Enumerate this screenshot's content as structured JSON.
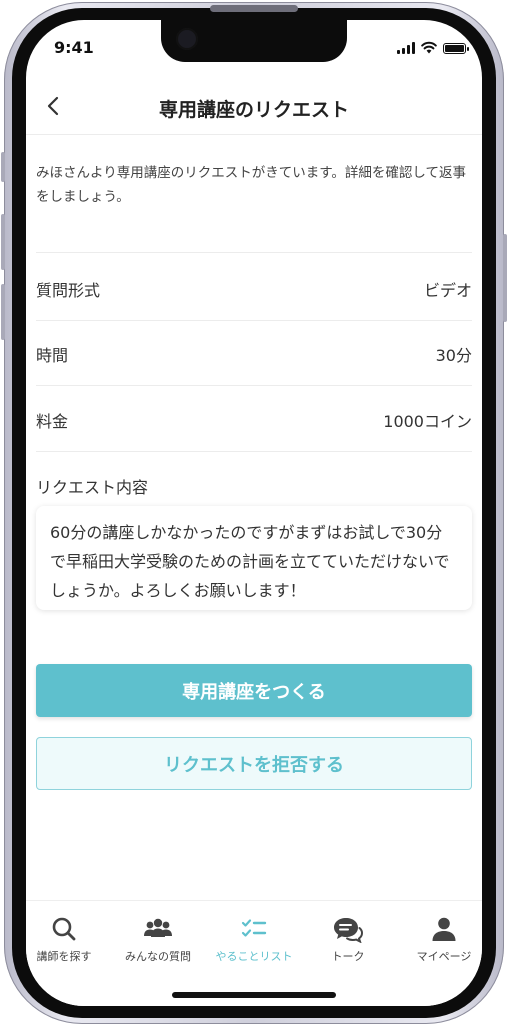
{
  "status": {
    "time": "9:41"
  },
  "nav": {
    "title": "専用講座のリクエスト"
  },
  "intro": "みほさんより専用講座のリクエストがきています。詳細を確認して返事をしましょう。",
  "details": [
    {
      "label": "質問形式",
      "value": "ビデオ"
    },
    {
      "label": "時間",
      "value": "30分"
    },
    {
      "label": "料金",
      "value": "1000コイン"
    }
  ],
  "request": {
    "label": "リクエスト内容",
    "text": "60分の講座しかなかったのですがまずはお試しで30分で早稲田大学受験のための計画を立てていただけないでしょうか。よろしくお願いします！"
  },
  "actions": {
    "create_label": "専用講座をつくる",
    "decline_label": "リクエストを拒否する"
  },
  "tabs": [
    {
      "label": "講師を探す",
      "icon": "search-icon"
    },
    {
      "label": "みんなの質問",
      "icon": "people-icon"
    },
    {
      "label": "やることリスト",
      "icon": "checklist-icon",
      "active": true
    },
    {
      "label": "トーク",
      "icon": "chat-icon"
    },
    {
      "label": "マイページ",
      "icon": "person-icon"
    }
  ],
  "colors": {
    "accent": "#5ec0cd",
    "accent_light": "#eefafb",
    "text": "#333333"
  }
}
